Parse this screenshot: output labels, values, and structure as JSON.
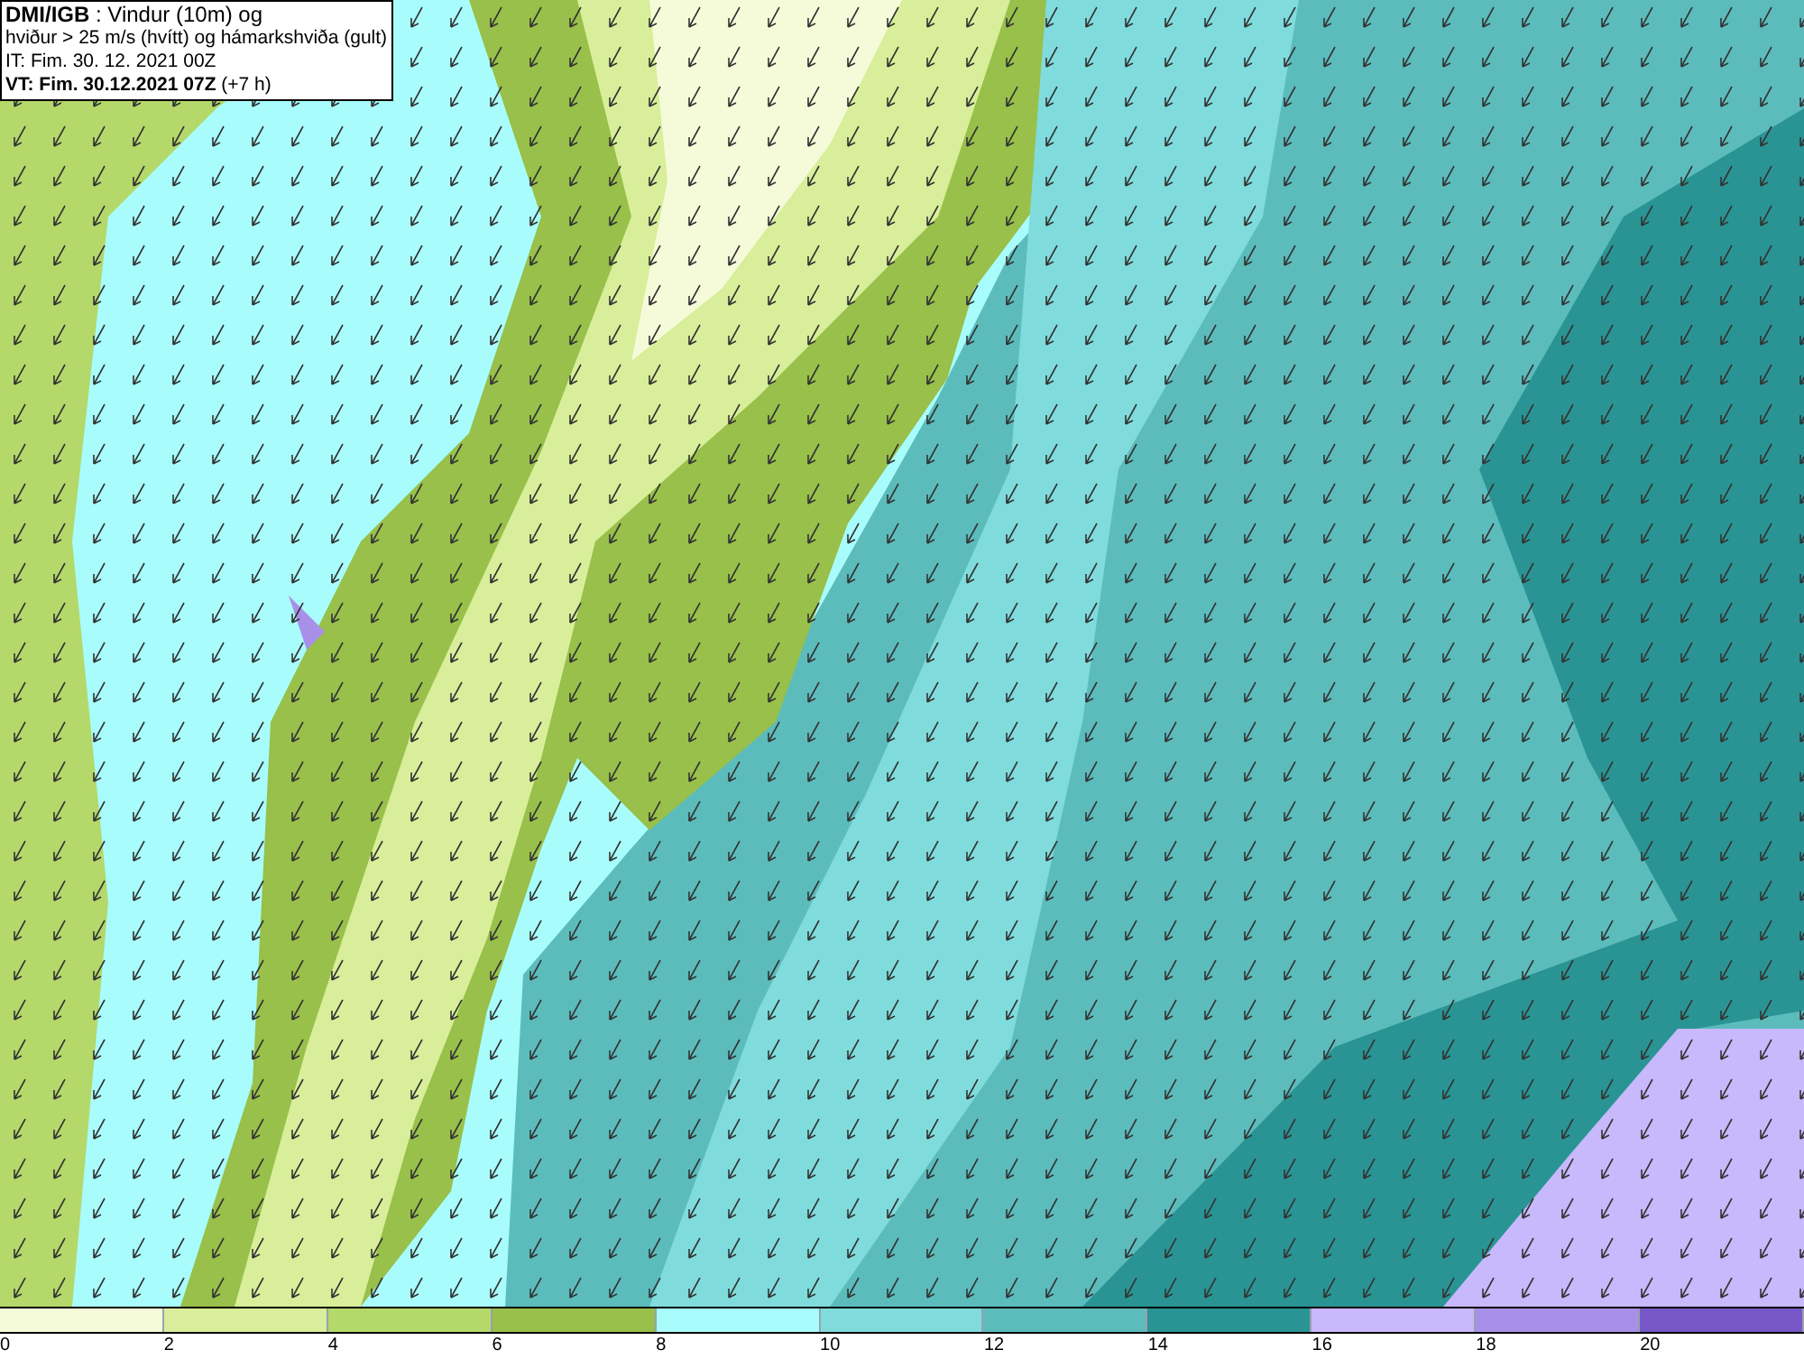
{
  "header": {
    "lines": [
      "**DMI/IGB** : Vindur (10m) og",
      "hviður > 25 m/s (hvítt) og hámarkshviða (gult)",
      "IT: Fim. 30. 12. 2021 00Z",
      "**VT: Fim. 30.12.2021 07Z** (+7 h)"
    ]
  },
  "legend": {
    "bins": [
      {
        "color": "#f5fbd9"
      },
      {
        "color": "#d8ee9a"
      },
      {
        "color": "#b4d86a"
      },
      {
        "color": "#98c04a"
      },
      {
        "color": "#a8fcfc"
      },
      {
        "color": "#80dcdc"
      },
      {
        "color": "#5cbcbc"
      },
      {
        "color": "#2a9494"
      },
      {
        "color": "#c8b8fc"
      },
      {
        "color": "#a890e8"
      },
      {
        "color": "#7858c8"
      }
    ],
    "ticks": [
      "0",
      "2",
      "4",
      "6",
      "8",
      "10",
      "12",
      "14",
      "16",
      "18",
      "20"
    ]
  }
}
